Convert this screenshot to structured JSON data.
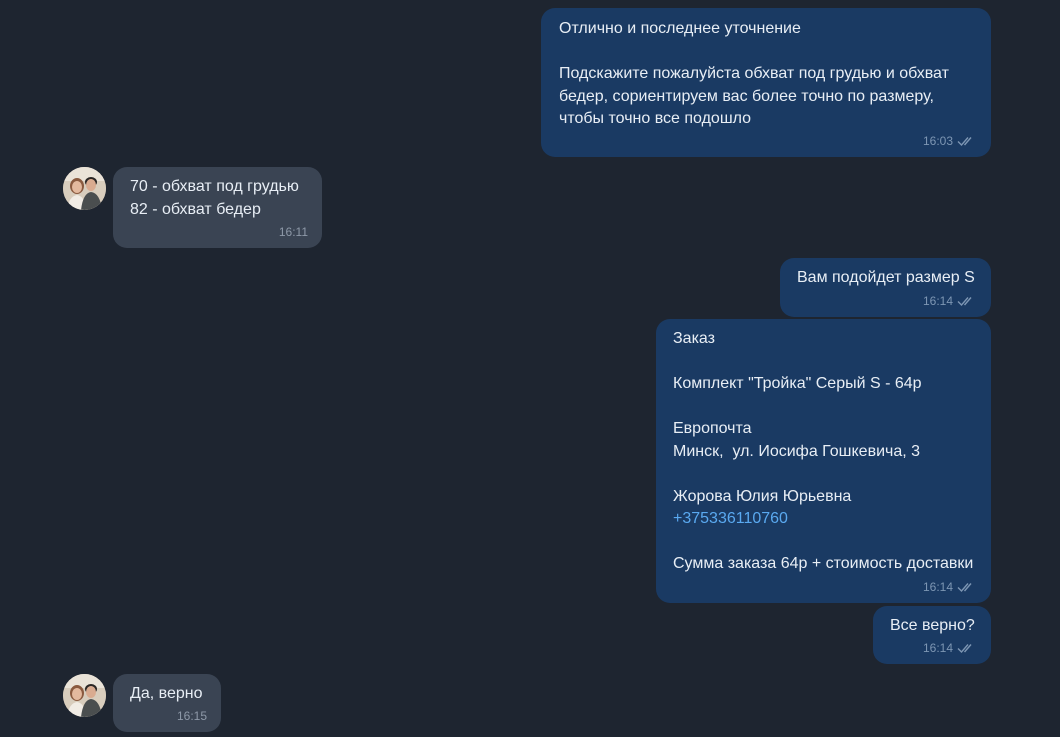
{
  "messages": [
    {
      "direction": "out",
      "lines": [
        "Отлично и последнее уточнение",
        "",
        "Подскажите пожалуйста обхват под грудью и обхват",
        "бедер, сориентируем вас более точно по размеру,",
        "чтобы точно все подошло"
      ],
      "time": "16:03",
      "read": true
    },
    {
      "direction": "in",
      "lines": [
        "70 - обхват под грудью",
        "82 - обхват бедер"
      ],
      "time": "16:11"
    },
    {
      "direction": "out",
      "lines": [
        "Вам подойдет размер S"
      ],
      "time": "16:14",
      "read": true
    },
    {
      "direction": "out",
      "lines": [
        "Заказ",
        "",
        "Комплект \"Тройка\" Серый S - 64р",
        "",
        "Европочта",
        "Минск,  ул. Иосифа Гошкевича, 3",
        "",
        "Жорова Юлия Юрьевна",
        "+375336110760",
        "",
        "Сумма заказа 64р + стоимость доставки"
      ],
      "link_line": 8,
      "time": "16:14",
      "read": true
    },
    {
      "direction": "out",
      "lines": [
        "Все верно?"
      ],
      "time": "16:14",
      "read": true
    },
    {
      "direction": "in",
      "lines": [
        "Да, верно"
      ],
      "time": "16:15"
    }
  ],
  "colors": {
    "background": "#1e2530",
    "outgoing_bubble": "#1a3a63",
    "incoming_bubble": "#3a4453",
    "link": "#5aa9f0"
  },
  "icons": {
    "read_receipt": "double-check-icon",
    "avatar": "user-avatar"
  }
}
